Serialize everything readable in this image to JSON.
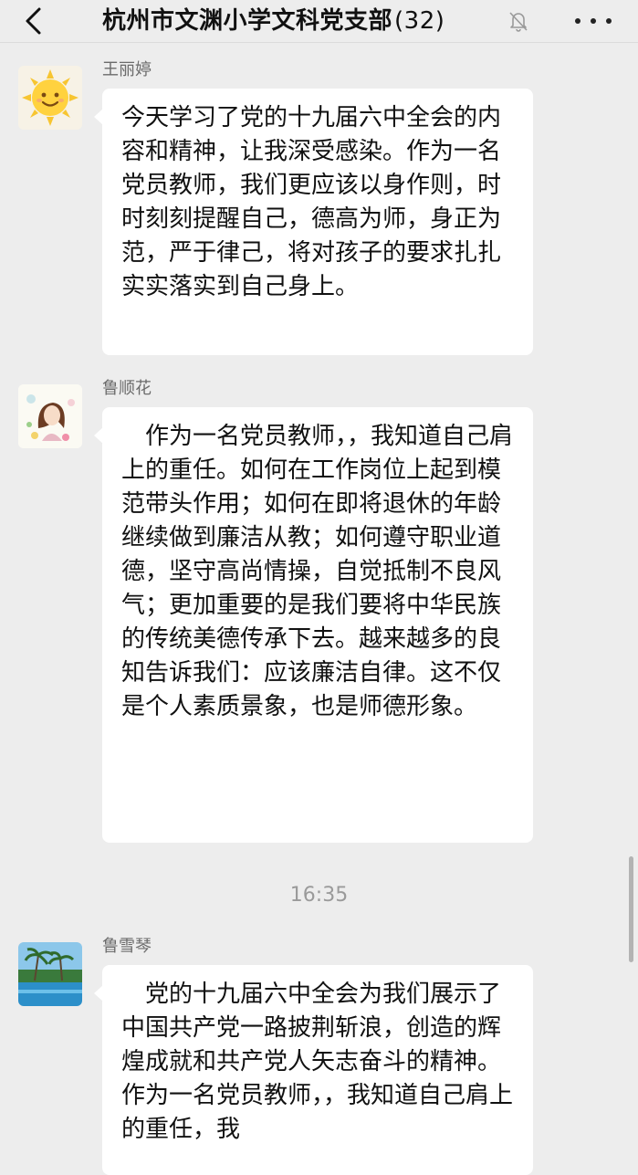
{
  "header": {
    "back_icon": "chevron-left-icon",
    "title": "杭州市文渊小学文科党支部",
    "member_count": "(32)",
    "mute_icon": "bell-muted-icon",
    "more_icon": "more-dots-icon"
  },
  "messages": [
    {
      "sender": "王丽婷",
      "avatar": "sun-avatar",
      "text": "今天学习了党的十九届六中全会的内容和精神，让我深受感染。作为一名党员教师，我们更应该以身作则，时时刻刻提醒自己，德高为师，身正为范，严于律己，将对孩子的要求扎扎实实落实到自己身上。"
    },
    {
      "sender": "鲁顺花",
      "avatar": "girl-portrait-avatar",
      "text": "　作为一名党员教师，，我知道自己肩上的重任。如何在工作岗位上起到模范带头作用；如何在即将退休的年龄继续做到廉洁从教；如何遵守职业道德，坚守高尚情操，自觉抵制不良风气；更加重要的是我们要将中华民族的传统美德传承下去。越来越多的良知告诉我们：应该廉洁自律。这不仅是个人素质景象，也是师德形象。"
    },
    {
      "sender": "鲁雪琴",
      "avatar": "palm-beach-avatar",
      "text": "　党的十九届六中全会为我们展示了中国共产党一路披荆斩浪，创造的辉煌成就和共产党人矢志奋斗的精神。作为一名党员教师，，我知道自己肩上的重任，我"
    }
  ],
  "timestamp": "16:35"
}
